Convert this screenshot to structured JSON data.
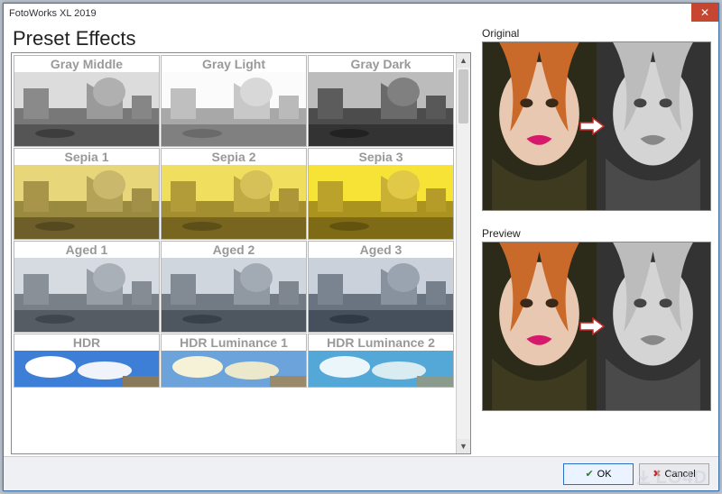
{
  "window": {
    "title": "FotoWorks XL 2019"
  },
  "heading": "Preset Effects",
  "presets": [
    {
      "label": "Gray Middle"
    },
    {
      "label": "Gray Light"
    },
    {
      "label": "Gray Dark"
    },
    {
      "label": "Sepia 1"
    },
    {
      "label": "Sepia 2"
    },
    {
      "label": "Sepia 3"
    },
    {
      "label": "Aged 1"
    },
    {
      "label": "Aged 2"
    },
    {
      "label": "Aged 3"
    },
    {
      "label": "HDR"
    },
    {
      "label": "HDR Luminance 1"
    },
    {
      "label": "HDR Luminance 2"
    }
  ],
  "panels": {
    "original_label": "Original",
    "preview_label": "Preview"
  },
  "buttons": {
    "ok": "OK",
    "cancel": "Cancel"
  },
  "watermark": "LO4D"
}
